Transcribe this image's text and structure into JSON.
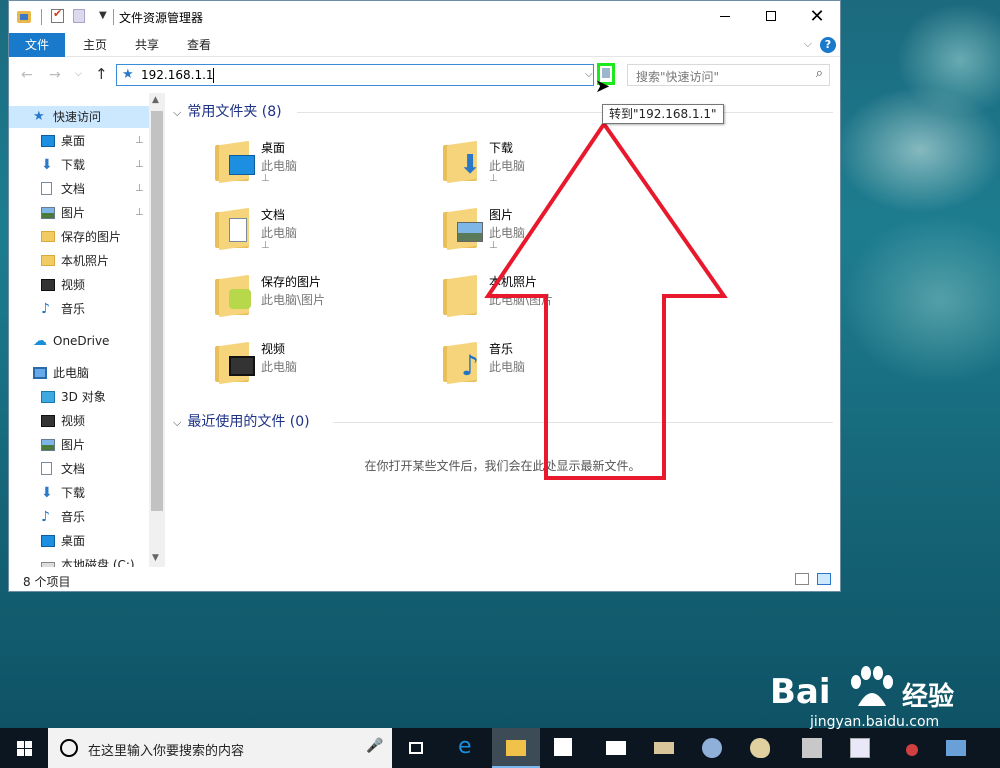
{
  "window": {
    "title": "文件资源管理器",
    "minimize": "—",
    "close": "✕"
  },
  "ribbon": {
    "tabs": [
      "文件",
      "主页",
      "共享",
      "查看"
    ],
    "expand": "⌵",
    "help": "?"
  },
  "nav": {
    "back": "←",
    "forward": "→",
    "history": "⌵",
    "up": "↑",
    "address": "192.168.1.1",
    "address_dropdown": "⌵",
    "search_placeholder": "搜索\"快速访问\"",
    "tooltip": "转到\"192.168.1.1\""
  },
  "sidebar": {
    "items": [
      {
        "label": "快速访问",
        "icon": "star-icon"
      },
      {
        "label": "桌面",
        "icon": "desktop-icon",
        "pinned": true
      },
      {
        "label": "下载",
        "icon": "download-icon",
        "pinned": true
      },
      {
        "label": "文档",
        "icon": "document-icon",
        "pinned": true
      },
      {
        "label": "图片",
        "icon": "pictures-icon",
        "pinned": true
      },
      {
        "label": "保存的图片",
        "icon": "folder-icon"
      },
      {
        "label": "本机照片",
        "icon": "folder-icon"
      },
      {
        "label": "视频",
        "icon": "video-icon"
      },
      {
        "label": "音乐",
        "icon": "music-icon"
      },
      {
        "label": "OneDrive",
        "icon": "onedrive-icon"
      },
      {
        "label": "此电脑",
        "icon": "computer-icon"
      },
      {
        "label": "3D 对象",
        "icon": "3d-objects-icon"
      },
      {
        "label": "视频",
        "icon": "video-icon"
      },
      {
        "label": "图片",
        "icon": "pictures-icon"
      },
      {
        "label": "文档",
        "icon": "document-icon"
      },
      {
        "label": "下载",
        "icon": "download-icon"
      },
      {
        "label": "音乐",
        "icon": "music-icon"
      },
      {
        "label": "桌面",
        "icon": "desktop-icon"
      },
      {
        "label": "本地磁盘 (C:)",
        "icon": "drive-icon"
      }
    ],
    "pin_glyph": "📌"
  },
  "content": {
    "frequent_header": "常用文件夹 (8)",
    "recent_header": "最近使用的文件 (0)",
    "chevron": "⌵",
    "folders": [
      {
        "name": "桌面",
        "location": "此电脑"
      },
      {
        "name": "下载",
        "location": "此电脑"
      },
      {
        "name": "文档",
        "location": "此电脑"
      },
      {
        "name": "图片",
        "location": "此电脑"
      },
      {
        "name": "保存的图片",
        "location": "此电脑\\图片"
      },
      {
        "name": "本机照片",
        "location": "此电脑\\图片"
      },
      {
        "name": "视频",
        "location": "此电脑"
      },
      {
        "name": "音乐",
        "location": "此电脑"
      }
    ],
    "empty_message": "在你打开某些文件后，我们会在此处显示最新文件。"
  },
  "status": {
    "item_count": "8 个项目"
  },
  "taskbar": {
    "search_placeholder": "在这里输入你要搜索的内容",
    "mic": "🎤"
  },
  "watermark": {
    "brand_latin": "Bai",
    "brand_cn": "经验",
    "url": "jingyan.baidu.com"
  },
  "colors": {
    "accent": "#1979ca",
    "go_button_highlight": "#1ee81e",
    "arrow": "#e8192c",
    "header_text": "#1e3287"
  }
}
